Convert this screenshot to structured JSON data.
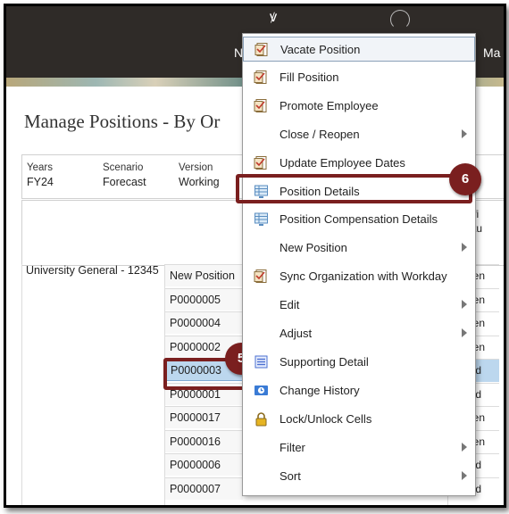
{
  "header": {
    "logo_glyph": "ꝟ",
    "nav_fragment_1": "N",
    "nav_fragment_2": "Ma"
  },
  "page": {
    "title": "Manage Positions - By Or"
  },
  "pov": [
    {
      "label": "Years",
      "value": "FY24"
    },
    {
      "label": "Scenario",
      "value": "Forecast"
    },
    {
      "label": "Version",
      "value": "Working"
    }
  ],
  "grid": {
    "column_header_line1": "Staffi",
    "column_header_line2": "Statu",
    "row_label": "University General - 12345",
    "positions": [
      "New Position",
      "P0000005",
      "P0000004",
      "P0000002",
      "P0000003",
      "P0000001",
      "P0000017",
      "P0000016",
      "P0000006",
      "P0000007"
    ],
    "statuses": [
      "pen",
      "pen",
      "pen",
      "pen",
      "led",
      "led",
      "pen",
      "pen",
      "led",
      "led"
    ],
    "selected_index": 4
  },
  "context_menu": {
    "items": [
      {
        "label": "Vacate Position",
        "icon": "form-icon",
        "submenu": false
      },
      {
        "label": "Fill Position",
        "icon": "form-icon",
        "submenu": false
      },
      {
        "label": "Promote Employee",
        "icon": "form-icon",
        "submenu": false
      },
      {
        "label": "Close / Reopen",
        "icon": "",
        "submenu": true
      },
      {
        "label": "Update Employee Dates",
        "icon": "form-icon",
        "submenu": false
      },
      {
        "label": "Position Details",
        "icon": "grid-icon",
        "submenu": false
      },
      {
        "label": "Position Compensation Details",
        "icon": "grid-icon",
        "submenu": false
      },
      {
        "label": "New Position",
        "icon": "",
        "submenu": true
      },
      {
        "label": "Sync Organization with Workday",
        "icon": "form-icon",
        "submenu": false
      },
      {
        "label": "Edit",
        "icon": "",
        "submenu": true
      },
      {
        "label": "Adjust",
        "icon": "",
        "submenu": true
      },
      {
        "label": "Supporting Detail",
        "icon": "list-icon",
        "submenu": false
      },
      {
        "label": "Change History",
        "icon": "history-icon",
        "submenu": false
      },
      {
        "label": "Lock/Unlock Cells",
        "icon": "lock-icon",
        "submenu": false
      },
      {
        "label": "Filter",
        "icon": "",
        "submenu": true
      },
      {
        "label": "Sort",
        "icon": "",
        "submenu": true
      }
    ]
  },
  "callouts": {
    "step5": "5",
    "step6": "6"
  },
  "colors": {
    "callout": "#7a1f1f",
    "selection": "#bcd7ee",
    "header_bg": "#2f2b28"
  }
}
